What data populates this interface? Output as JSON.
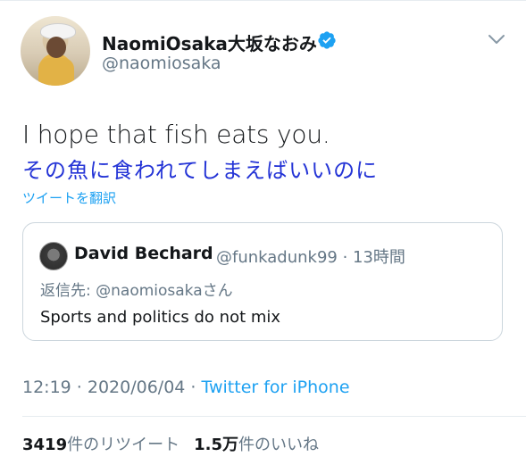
{
  "tweet": {
    "author": {
      "display_name": "NaomiOsaka大坂なおみ",
      "handle": "@naomiosaka",
      "verified": true
    },
    "text": "I hope that fish eats you.",
    "translation": "その魚に食われてしまえばいいのに",
    "translate_label": "ツイートを翻訳",
    "quoted": {
      "name": "David Bechard",
      "handle_time": "@funkadunk99 · 13時間",
      "reply_to": "返信先: @naomiosakaさん",
      "text": "Sports and politics do not mix"
    },
    "timestamp": "12:19 · 2020/06/04 · ",
    "source": "Twitter for iPhone",
    "stats": {
      "retweets_count": "3419",
      "retweets_label": "件のリツイート",
      "likes_count": "1.5万",
      "likes_label": "件のいいね"
    }
  },
  "colors": {
    "accent": "#1da1f2",
    "translation_text": "#2434d6",
    "secondary_text": "#657786",
    "border": "#ccd6dd"
  },
  "icons": {
    "verified": "verified-badge-icon",
    "menu": "chevron-down-icon"
  }
}
